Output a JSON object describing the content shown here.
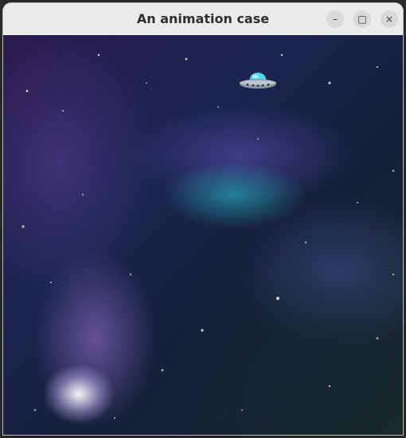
{
  "window": {
    "title": "An animation case",
    "controls": {
      "minimize_glyph": "–",
      "maximize_glyph": "□",
      "close_glyph": "×"
    }
  },
  "canvas": {
    "background": "space nebula image",
    "sprite": "ufo-icon",
    "colors": {
      "ufo_dome": "#4fd6f0",
      "ufo_body": "#8a9aa8"
    }
  }
}
